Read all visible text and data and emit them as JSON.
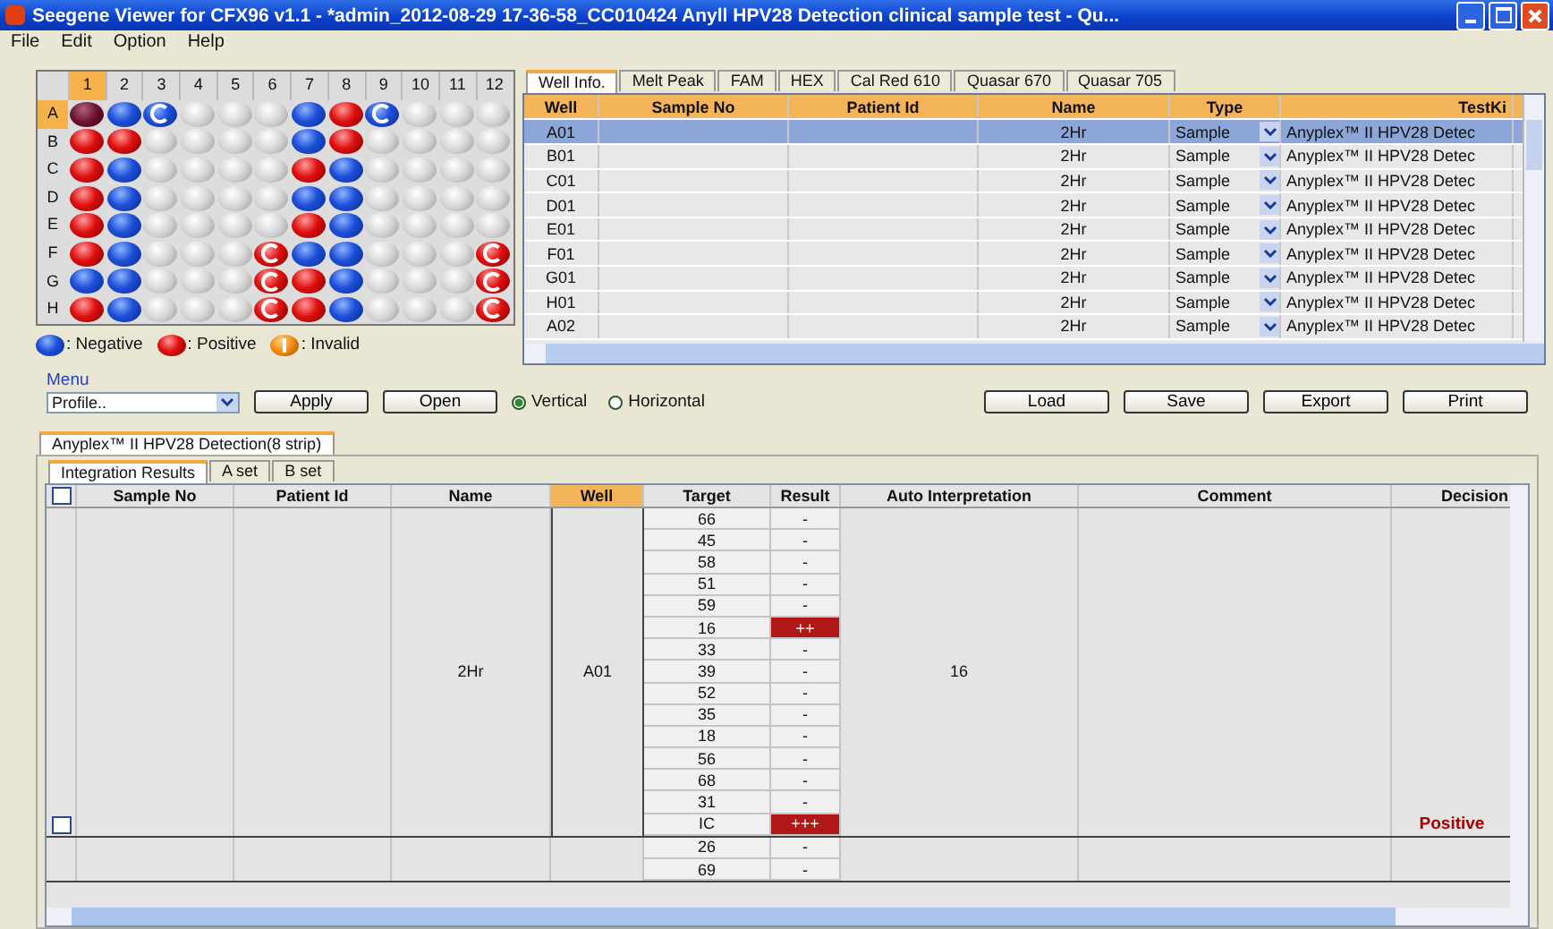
{
  "window": {
    "title": "Seegene Viewer for CFX96 v1.1 - *admin_2012-08-29 17-36-58_CC010424 Anyll HPV28 Detection clinical sample test - Qu..."
  },
  "menu_bar": [
    "File",
    "Edit",
    "Option",
    "Help"
  ],
  "plate": {
    "columns": [
      {
        "label": "1",
        "selected": true
      },
      {
        "label": "2",
        "selected": false
      },
      {
        "label": "3",
        "selected": false
      },
      {
        "label": "4",
        "selected": false
      },
      {
        "label": "5",
        "selected": false
      },
      {
        "label": "6",
        "selected": false
      },
      {
        "label": "7",
        "selected": false
      },
      {
        "label": "8",
        "selected": false
      },
      {
        "label": "9",
        "selected": false
      },
      {
        "label": "10",
        "selected": false
      },
      {
        "label": "11",
        "selected": false
      },
      {
        "label": "12",
        "selected": false
      }
    ],
    "rows": [
      {
        "label": "A",
        "selected": true,
        "wells": [
          {
            "kind": "current",
            "marked": false
          },
          {
            "kind": "neg",
            "marked": false
          },
          {
            "kind": "neg",
            "marked": true
          },
          {
            "kind": "empty",
            "marked": false
          },
          {
            "kind": "empty",
            "marked": false
          },
          {
            "kind": "empty",
            "marked": false
          },
          {
            "kind": "neg",
            "marked": false
          },
          {
            "kind": "pos",
            "marked": false
          },
          {
            "kind": "neg",
            "marked": true
          },
          {
            "kind": "empty",
            "marked": false
          },
          {
            "kind": "empty",
            "marked": false
          },
          {
            "kind": "empty",
            "marked": false
          }
        ]
      },
      {
        "label": "B",
        "selected": false,
        "wells": [
          {
            "kind": "pos",
            "marked": false
          },
          {
            "kind": "pos",
            "marked": false
          },
          {
            "kind": "empty",
            "marked": false
          },
          {
            "kind": "empty",
            "marked": false
          },
          {
            "kind": "empty",
            "marked": false
          },
          {
            "kind": "empty",
            "marked": false
          },
          {
            "kind": "neg",
            "marked": false
          },
          {
            "kind": "pos",
            "marked": false
          },
          {
            "kind": "empty",
            "marked": false
          },
          {
            "kind": "empty",
            "marked": false
          },
          {
            "kind": "empty",
            "marked": false
          },
          {
            "kind": "empty",
            "marked": false
          }
        ]
      },
      {
        "label": "C",
        "selected": false,
        "wells": [
          {
            "kind": "pos",
            "marked": false
          },
          {
            "kind": "neg",
            "marked": false
          },
          {
            "kind": "empty",
            "marked": false
          },
          {
            "kind": "empty",
            "marked": false
          },
          {
            "kind": "empty",
            "marked": false
          },
          {
            "kind": "empty",
            "marked": false
          },
          {
            "kind": "pos",
            "marked": false
          },
          {
            "kind": "neg",
            "marked": false
          },
          {
            "kind": "empty",
            "marked": false
          },
          {
            "kind": "empty",
            "marked": false
          },
          {
            "kind": "empty",
            "marked": false
          },
          {
            "kind": "empty",
            "marked": false
          }
        ]
      },
      {
        "label": "D",
        "selected": false,
        "wells": [
          {
            "kind": "pos",
            "marked": false
          },
          {
            "kind": "neg",
            "marked": false
          },
          {
            "kind": "empty",
            "marked": false
          },
          {
            "kind": "empty",
            "marked": false
          },
          {
            "kind": "empty",
            "marked": false
          },
          {
            "kind": "empty",
            "marked": false
          },
          {
            "kind": "neg",
            "marked": false
          },
          {
            "kind": "neg",
            "marked": false
          },
          {
            "kind": "empty",
            "marked": false
          },
          {
            "kind": "empty",
            "marked": false
          },
          {
            "kind": "empty",
            "marked": false
          },
          {
            "kind": "empty",
            "marked": false
          }
        ]
      },
      {
        "label": "E",
        "selected": false,
        "wells": [
          {
            "kind": "pos",
            "marked": false
          },
          {
            "kind": "neg",
            "marked": false
          },
          {
            "kind": "empty",
            "marked": false
          },
          {
            "kind": "empty",
            "marked": false
          },
          {
            "kind": "empty",
            "marked": false
          },
          {
            "kind": "empty",
            "marked": false
          },
          {
            "kind": "pos",
            "marked": false
          },
          {
            "kind": "neg",
            "marked": false
          },
          {
            "kind": "empty",
            "marked": false
          },
          {
            "kind": "empty",
            "marked": false
          },
          {
            "kind": "empty",
            "marked": false
          },
          {
            "kind": "empty",
            "marked": false
          }
        ]
      },
      {
        "label": "F",
        "selected": false,
        "wells": [
          {
            "kind": "pos",
            "marked": false
          },
          {
            "kind": "neg",
            "marked": false
          },
          {
            "kind": "empty",
            "marked": false
          },
          {
            "kind": "empty",
            "marked": false
          },
          {
            "kind": "empty",
            "marked": false
          },
          {
            "kind": "pos",
            "marked": true
          },
          {
            "kind": "neg",
            "marked": false
          },
          {
            "kind": "neg",
            "marked": false
          },
          {
            "kind": "empty",
            "marked": false
          },
          {
            "kind": "empty",
            "marked": false
          },
          {
            "kind": "empty",
            "marked": false
          },
          {
            "kind": "pos",
            "marked": true
          }
        ]
      },
      {
        "label": "G",
        "selected": false,
        "wells": [
          {
            "kind": "neg",
            "marked": false
          },
          {
            "kind": "neg",
            "marked": false
          },
          {
            "kind": "empty",
            "marked": false
          },
          {
            "kind": "empty",
            "marked": false
          },
          {
            "kind": "empty",
            "marked": false
          },
          {
            "kind": "pos",
            "marked": true
          },
          {
            "kind": "pos",
            "marked": false
          },
          {
            "kind": "neg",
            "marked": false
          },
          {
            "kind": "empty",
            "marked": false
          },
          {
            "kind": "empty",
            "marked": false
          },
          {
            "kind": "empty",
            "marked": false
          },
          {
            "kind": "pos",
            "marked": true
          }
        ]
      },
      {
        "label": "H",
        "selected": false,
        "wells": [
          {
            "kind": "pos",
            "marked": false
          },
          {
            "kind": "neg",
            "marked": false
          },
          {
            "kind": "empty",
            "marked": false
          },
          {
            "kind": "empty",
            "marked": false
          },
          {
            "kind": "empty",
            "marked": false
          },
          {
            "kind": "pos",
            "marked": true
          },
          {
            "kind": "pos",
            "marked": false
          },
          {
            "kind": "neg",
            "marked": false
          },
          {
            "kind": "empty",
            "marked": false
          },
          {
            "kind": "empty",
            "marked": false
          },
          {
            "kind": "empty",
            "marked": false
          },
          {
            "kind": "pos",
            "marked": true
          }
        ]
      }
    ]
  },
  "legend": [
    {
      "kind": "neg",
      "label": ": Negative"
    },
    {
      "kind": "pos",
      "label": ": Positive"
    },
    {
      "kind": "invalid",
      "label": ": Invalid"
    }
  ],
  "menu": {
    "label": "Menu",
    "profile": "Profile..",
    "buttons": [
      "Apply",
      "Open"
    ]
  },
  "orientation": [
    {
      "label": "Vertical",
      "selected": true
    },
    {
      "label": "Horizontal",
      "selected": false
    }
  ],
  "actions": [
    "Load",
    "Save",
    "Export",
    "Print"
  ],
  "well_tabs": [
    {
      "label": "Well Info.",
      "selected": true
    },
    {
      "label": "Melt Peak",
      "selected": false
    },
    {
      "label": "FAM",
      "selected": false
    },
    {
      "label": "HEX",
      "selected": false
    },
    {
      "label": "Cal Red 610",
      "selected": false
    },
    {
      "label": "Quasar 670",
      "selected": false
    },
    {
      "label": "Quasar 705",
      "selected": false
    }
  ],
  "well_table": {
    "columns": [
      "Well",
      "Sample No",
      "Patient Id",
      "Name",
      "Type",
      "TestKi"
    ],
    "rows": [
      {
        "well": "A01",
        "name": "2Hr",
        "type": "Sample",
        "test_kit": "Anyplex™ II HPV28 Detec",
        "selected": true
      },
      {
        "well": "B01",
        "name": "2Hr",
        "type": "Sample",
        "test_kit": "Anyplex™ II HPV28 Detec",
        "selected": false
      },
      {
        "well": "C01",
        "name": "2Hr",
        "type": "Sample",
        "test_kit": "Anyplex™ II HPV28 Detec",
        "selected": false
      },
      {
        "well": "D01",
        "name": "2Hr",
        "type": "Sample",
        "test_kit": "Anyplex™ II HPV28 Detec",
        "selected": false
      },
      {
        "well": "E01",
        "name": "2Hr",
        "type": "Sample",
        "test_kit": "Anyplex™ II HPV28 Detec",
        "selected": false
      },
      {
        "well": "F01",
        "name": "2Hr",
        "type": "Sample",
        "test_kit": "Anyplex™ II HPV28 Detec",
        "selected": false
      },
      {
        "well": "G01",
        "name": "2Hr",
        "type": "Sample",
        "test_kit": "Anyplex™ II HPV28 Detec",
        "selected": false
      },
      {
        "well": "H01",
        "name": "2Hr",
        "type": "Sample",
        "test_kit": "Anyplex™ II HPV28 Detec",
        "selected": false
      },
      {
        "well": "A02",
        "name": "2Hr",
        "type": "Sample",
        "test_kit": "Anyplex™ II HPV28 Detec",
        "selected": false
      }
    ]
  },
  "assay_tabs": [
    {
      "label": "Anyplex™ II HPV28 Detection(8 strip)",
      "selected": true
    }
  ],
  "result_tabs": [
    {
      "label": "Integration Results",
      "selected": true
    },
    {
      "label": "A set",
      "selected": false
    },
    {
      "label": "B set",
      "selected": false
    }
  ],
  "results_table": {
    "header_checked": false,
    "columns": [
      {
        "label": "Sample No",
        "selected": false
      },
      {
        "label": "Patient Id",
        "selected": false
      },
      {
        "label": "Name",
        "selected": false
      },
      {
        "label": "Well",
        "selected": true
      },
      {
        "label": "Target",
        "selected": false
      },
      {
        "label": "Result",
        "selected": false
      },
      {
        "label": "Auto Interpretation",
        "selected": false
      },
      {
        "label": "Comment",
        "selected": false
      },
      {
        "label": "Decision",
        "selected": false
      }
    ],
    "groups": [
      {
        "name": "2Hr",
        "well": "A01",
        "auto_interpretation": "16",
        "decision": "Positive",
        "checked": false,
        "targets": [
          {
            "target": "66",
            "result": "-",
            "positive": false
          },
          {
            "target": "45",
            "result": "-",
            "positive": false
          },
          {
            "target": "58",
            "result": "-",
            "positive": false
          },
          {
            "target": "51",
            "result": "-",
            "positive": false
          },
          {
            "target": "59",
            "result": "-",
            "positive": false
          },
          {
            "target": "16",
            "result": "++",
            "positive": true
          },
          {
            "target": "33",
            "result": "-",
            "positive": false
          },
          {
            "target": "39",
            "result": "-",
            "positive": false
          },
          {
            "target": "52",
            "result": "-",
            "positive": false
          },
          {
            "target": "35",
            "result": "-",
            "positive": false
          },
          {
            "target": "18",
            "result": "-",
            "positive": false
          },
          {
            "target": "56",
            "result": "-",
            "positive": false
          },
          {
            "target": "68",
            "result": "-",
            "positive": false
          },
          {
            "target": "31",
            "result": "-",
            "positive": false
          },
          {
            "target": "IC",
            "result": "+++",
            "positive": true
          }
        ]
      },
      {
        "targets": [
          {
            "target": "26",
            "result": "-",
            "positive": false
          },
          {
            "target": "69",
            "result": "-",
            "positive": false
          }
        ]
      }
    ]
  }
}
